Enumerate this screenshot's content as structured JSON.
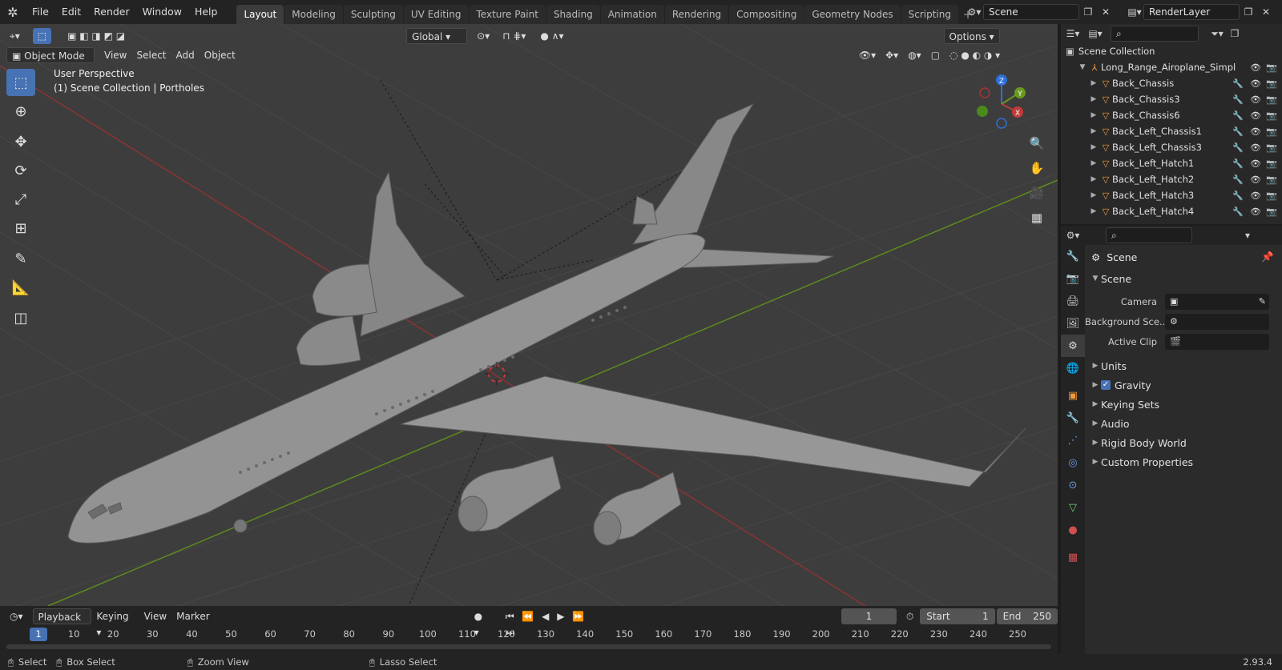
{
  "app": {
    "menu": [
      "File",
      "Edit",
      "Render",
      "Window",
      "Help"
    ],
    "workspaces": [
      "Layout",
      "Modeling",
      "Sculpting",
      "UV Editing",
      "Texture Paint",
      "Shading",
      "Animation",
      "Rendering",
      "Compositing",
      "Geometry Nodes",
      "Scripting"
    ],
    "active_workspace": "Layout",
    "scene_name": "Scene",
    "render_layer": "RenderLayer",
    "version": "2.93.4"
  },
  "viewport": {
    "mode": "Object Mode",
    "menus": [
      "View",
      "Select",
      "Add",
      "Object"
    ],
    "transform_orientation": "Global",
    "options_label": "Options",
    "perspective_label": "User Perspective",
    "collection_label": "(1) Scene Collection | Portholes",
    "gizmo_axes": [
      "X",
      "Y",
      "Z"
    ]
  },
  "outliner": {
    "root": "Scene Collection",
    "collection": "Long_Range_Airoplane_Simpl",
    "items": [
      "Back_Chassis",
      "Back_Chassis3",
      "Back_Chassis6",
      "Back_Left_Chassis1",
      "Back_Left_Chassis3",
      "Back_Left_Hatch1",
      "Back_Left_Hatch2",
      "Back_Left_Hatch3",
      "Back_Left_Hatch4"
    ]
  },
  "properties": {
    "context": "Scene",
    "panel": "Scene",
    "fields": [
      {
        "label": "Camera",
        "value": ""
      },
      {
        "label": "Background Sce...",
        "value": ""
      },
      {
        "label": "Active Clip",
        "value": ""
      }
    ],
    "subpanels": [
      "Units",
      "Gravity",
      "Keying Sets",
      "Audio",
      "Rigid Body World",
      "Custom Properties"
    ],
    "gravity_checked": true
  },
  "timeline": {
    "menus": [
      "Playback",
      "Keying",
      "View",
      "Marker"
    ],
    "current_frame": "1",
    "start_label": "Start",
    "start": "1",
    "end_label": "End",
    "end": "250",
    "ticks": [
      "1",
      "10",
      "20",
      "30",
      "40",
      "50",
      "60",
      "70",
      "80",
      "90",
      "100",
      "110",
      "120",
      "130",
      "140",
      "150",
      "160",
      "170",
      "180",
      "190",
      "200",
      "210",
      "220",
      "230",
      "240",
      "250"
    ]
  },
  "statusbar": {
    "select": "Select",
    "box_select": "Box Select",
    "zoom_view": "Zoom View",
    "lasso_select": "Lasso Select"
  },
  "colors": {
    "accent": "#4772b3",
    "x_axis": "#c23a3a",
    "y_axis": "#6a9a1f",
    "z_axis": "#2f6fd6",
    "object": "#f09a3a"
  }
}
